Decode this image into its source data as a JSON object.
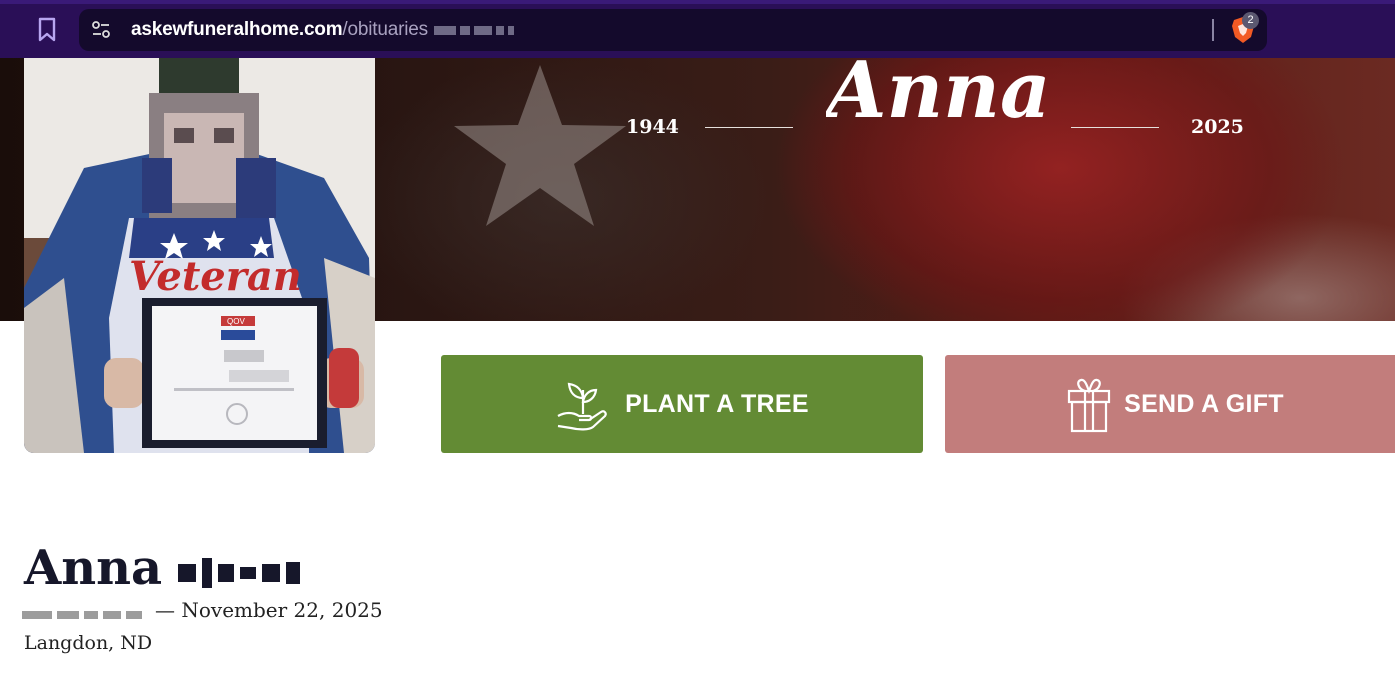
{
  "browser": {
    "url_domain": "askewfuneralhome.com",
    "url_path": "/obituaries",
    "shields_count": "2",
    "colors": {
      "chrome": "#2a0f57",
      "url_field": "#140a2c"
    }
  },
  "hero": {
    "birth_year": "1944",
    "death_year": "2025",
    "script_name": "Anna"
  },
  "actions": {
    "plant_tree_label": "PLANT A TREE",
    "send_gift_label": "SEND A GIFT",
    "colors": {
      "plant_tree": "#638b34",
      "send_gift": "#c27d7c"
    }
  },
  "obituary": {
    "first_name": "Anna",
    "date_separator_and_death": "— November 22, 2025",
    "location": "Langdon, ND"
  },
  "portrait": {
    "shirt_text": "Veteran",
    "certificate_header": "QOV"
  }
}
